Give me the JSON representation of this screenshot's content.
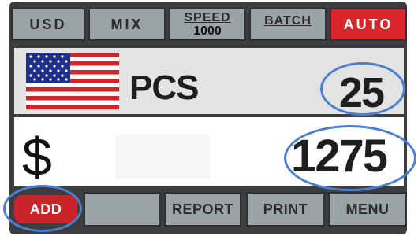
{
  "top_buttons": {
    "usd": "USD",
    "mix": "MIX",
    "speed_label": "SPEED",
    "speed_value": "1000",
    "batch": "BATCH",
    "auto": "AUTO"
  },
  "count_panel": {
    "flag_icon": "us-flag-icon",
    "unit": "PCS",
    "value": "25"
  },
  "amount_panel": {
    "currency_symbol": "$",
    "value": "1275"
  },
  "bottom_buttons": {
    "add": "ADD",
    "blank": "",
    "report": "REPORT",
    "print": "PRINT",
    "menu": "MENU"
  },
  "colors": {
    "active_red": "#d9262b",
    "button_gray": "#9aa4a7",
    "frame_dark": "#3c3d3f",
    "highlight_ring_blue": "#4a7fd1"
  }
}
